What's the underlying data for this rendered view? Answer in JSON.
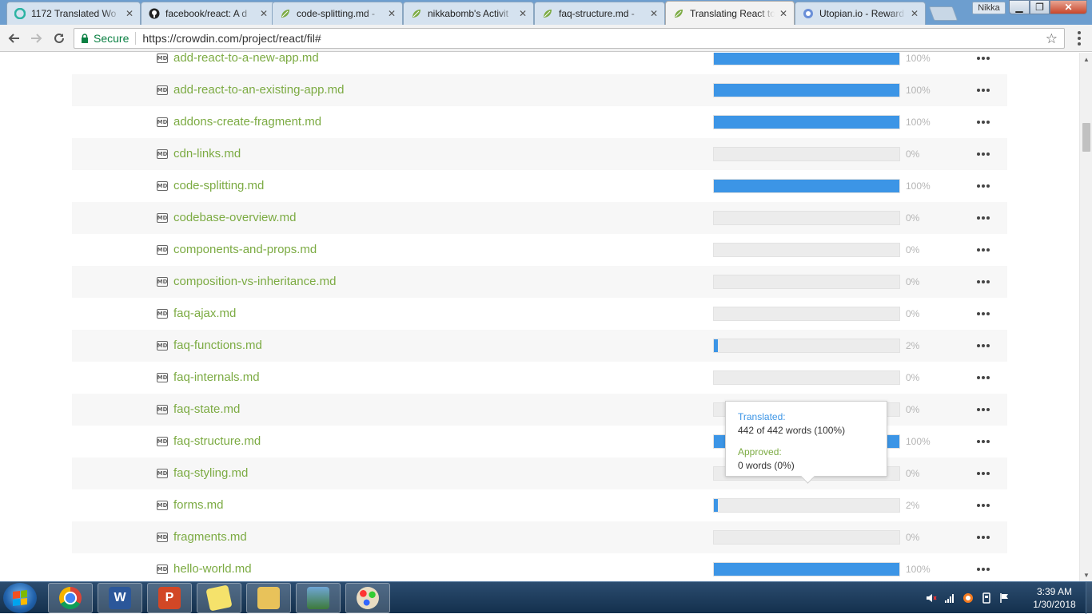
{
  "browser": {
    "tabs": [
      {
        "title": "1172 Translated Wo",
        "icon": "crowdin-c-icon",
        "active": false
      },
      {
        "title": "facebook/react: A d",
        "icon": "github-icon",
        "active": false
      },
      {
        "title": "code-splitting.md - ",
        "icon": "crowdin-leaf-icon",
        "active": false
      },
      {
        "title": "nikkabomb's Activit",
        "icon": "crowdin-leaf-icon",
        "active": false
      },
      {
        "title": "faq-structure.md - ",
        "icon": "crowdin-leaf-icon",
        "active": false
      },
      {
        "title": "Translating React to",
        "icon": "crowdin-leaf-icon",
        "active": true
      },
      {
        "title": "Utopian.io - Reward",
        "icon": "utopian-icon",
        "active": false
      }
    ],
    "close_glyph": "✕",
    "profile_name": "Nikka",
    "secure_label": "Secure",
    "url": "https://crowdin.com/project/react/fil#"
  },
  "files": [
    {
      "name": "add-react-to-a-new-app.md",
      "progress": 100,
      "pct_label": "100%"
    },
    {
      "name": "add-react-to-an-existing-app.md",
      "progress": 100,
      "pct_label": "100%"
    },
    {
      "name": "addons-create-fragment.md",
      "progress": 100,
      "pct_label": "100%"
    },
    {
      "name": "cdn-links.md",
      "progress": 0,
      "pct_label": "0%"
    },
    {
      "name": "code-splitting.md",
      "progress": 100,
      "pct_label": "100%"
    },
    {
      "name": "codebase-overview.md",
      "progress": 0,
      "pct_label": "0%"
    },
    {
      "name": "components-and-props.md",
      "progress": 0,
      "pct_label": "0%"
    },
    {
      "name": "composition-vs-inheritance.md",
      "progress": 0,
      "pct_label": "0%"
    },
    {
      "name": "faq-ajax.md",
      "progress": 0,
      "pct_label": "0%"
    },
    {
      "name": "faq-functions.md",
      "progress": 2,
      "pct_label": "2%"
    },
    {
      "name": "faq-internals.md",
      "progress": 0,
      "pct_label": "0%"
    },
    {
      "name": "faq-state.md",
      "progress": 0,
      "pct_label": "0%"
    },
    {
      "name": "faq-structure.md",
      "progress": 100,
      "pct_label": "100%"
    },
    {
      "name": "faq-styling.md",
      "progress": 0,
      "pct_label": "0%"
    },
    {
      "name": "forms.md",
      "progress": 2,
      "pct_label": "2%"
    },
    {
      "name": "fragments.md",
      "progress": 0,
      "pct_label": "0%"
    },
    {
      "name": "hello-world.md",
      "progress": 100,
      "pct_label": "100%"
    }
  ],
  "file_icon_label": "MD",
  "tooltip": {
    "translated_label": "Translated:",
    "translated_value": "442 of 442 words (100%)",
    "approved_label": "Approved:",
    "approved_value": "0 words (0%)"
  },
  "taskbar": {
    "apps": [
      "chrome-icon",
      "word-icon",
      "powerpoint-icon",
      "sticky-notes-icon",
      "file-explorer-icon",
      "photo-viewer-icon",
      "paint-icon"
    ],
    "clock_time": "3:39 AM",
    "clock_date": "1/30/2018"
  },
  "colors": {
    "progress_fill": "#3c95e6",
    "file_link": "#7cab43",
    "secure_green": "#0b8043"
  }
}
